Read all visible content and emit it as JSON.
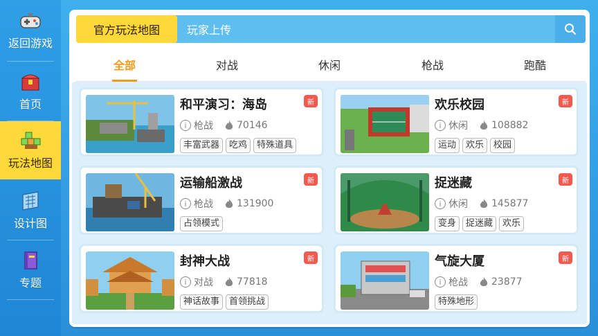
{
  "sidebar": {
    "items": [
      {
        "label": "返回游戏",
        "icon": "gamepad-icon"
      },
      {
        "label": "首页",
        "icon": "treasure-chest-icon"
      },
      {
        "label": "玩法地图",
        "icon": "blocks-icon"
      },
      {
        "label": "设计图",
        "icon": "blueprint-icon"
      },
      {
        "label": "专题",
        "icon": "book-icon"
      }
    ],
    "active_index": 2
  },
  "topbar": {
    "official_tab": "官方玩法地图",
    "upload_tab": "玩家上传"
  },
  "categories": [
    "全部",
    "对战",
    "休闲",
    "枪战",
    "跑酷"
  ],
  "active_category": 0,
  "new_badge": "新",
  "colors": {
    "accent": "#f39a1b",
    "highlight": "#ffd83a",
    "badge": "#f05a4f",
    "topbar": "#5fbef0"
  },
  "cards": [
    {
      "title": "和平演习：海岛",
      "category": "枪战",
      "plays": "70146",
      "tags": [
        "丰富武器",
        "吃鸡",
        "特殊道具"
      ]
    },
    {
      "title": "欢乐校园",
      "category": "休闲",
      "plays": "108882",
      "tags": [
        "运动",
        "欢乐",
        "校园"
      ]
    },
    {
      "title": "运输船激战",
      "category": "枪战",
      "plays": "131900",
      "tags": [
        "占领模式"
      ]
    },
    {
      "title": "捉迷藏",
      "category": "休闲",
      "plays": "145877",
      "tags": [
        "变身",
        "捉迷藏",
        "欢乐"
      ]
    },
    {
      "title": "封神大战",
      "category": "对战",
      "plays": "77818",
      "tags": [
        "神话故事",
        "首领挑战"
      ]
    },
    {
      "title": "气旋大厦",
      "category": "枪战",
      "plays": "23877",
      "tags": [
        "特殊地形"
      ]
    }
  ]
}
